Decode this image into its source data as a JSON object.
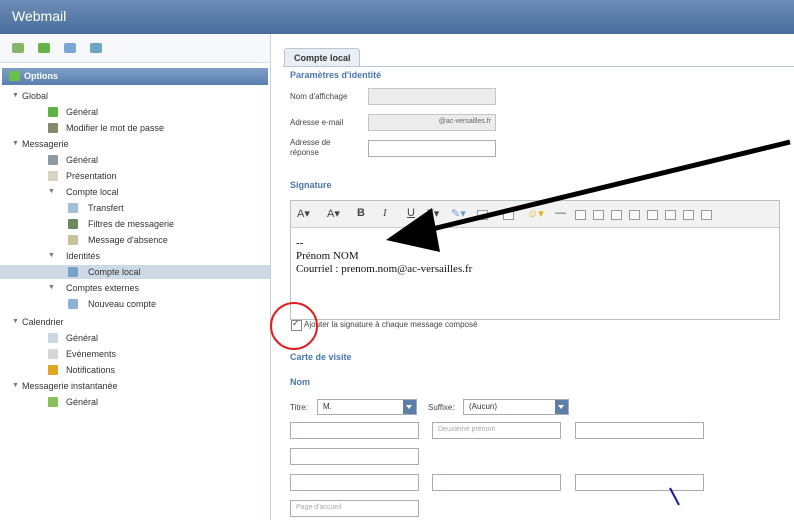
{
  "app": {
    "title": "Webmail"
  },
  "sidebar": {
    "header": "Options",
    "items": [
      {
        "label": "Global"
      },
      {
        "label": "Général"
      },
      {
        "label": "Modifier le mot de passe"
      },
      {
        "label": "Messagerie"
      },
      {
        "label": "Général"
      },
      {
        "label": "Présentation"
      },
      {
        "label": "Compte local"
      },
      {
        "label": "Transfert"
      },
      {
        "label": "Filtres de messagerie"
      },
      {
        "label": "Message d'absence"
      },
      {
        "label": "Identités"
      },
      {
        "label": "Compte local"
      },
      {
        "label": "Comptes externes"
      },
      {
        "label": "Nouveau compte"
      },
      {
        "label": "Calendrier"
      },
      {
        "label": "Général"
      },
      {
        "label": "Evénements"
      },
      {
        "label": "Notifications"
      },
      {
        "label": "Messagerie instantanée"
      },
      {
        "label": "Général"
      }
    ]
  },
  "main": {
    "tab": "Compte local",
    "identity": {
      "title": "Paramètres d'identité",
      "display_name_label": "Nom d'affichage",
      "display_name_value": "",
      "email_label": "Adresse e-mail",
      "email_value": "@ac-versailles.fr",
      "reply_label_1": "Adresse de",
      "reply_label_2": "réponse",
      "reply_value": ""
    },
    "signature": {
      "title": "Signature",
      "toolbar": {
        "bold": "B",
        "italic": "I",
        "underline": "U"
      },
      "line1": "--",
      "line2": "Prénom NOM",
      "line3": "Courriel : prenom.nom@ac-versailles.fr",
      "append_label": "Ajouter la signature à chaque message composé"
    },
    "vcard": {
      "title": "Carte de visite",
      "name_section": "Nom",
      "title_label": "Titre:",
      "title_value": "M.",
      "suffix_label": "Suffixe:",
      "suffix_value": "(Aucun)",
      "middle_name_placeholder": "Deuxième prénom",
      "homepage_placeholder": "Page d'accueil"
    }
  },
  "colors": {
    "accent": "#4a78b0",
    "titlebar": "#5a7fab",
    "annotation": "#e02020"
  }
}
